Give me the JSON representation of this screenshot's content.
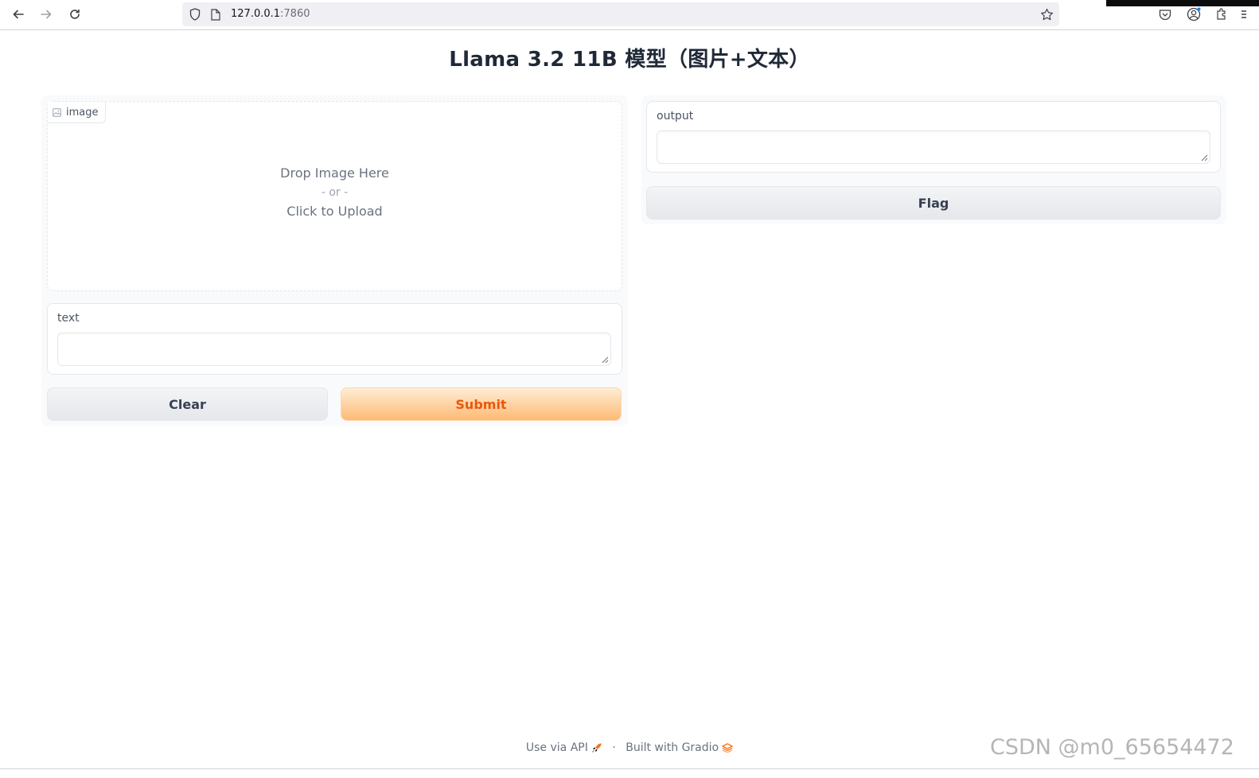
{
  "browser": {
    "url_host": "127.0.0.1",
    "url_port": ":7860"
  },
  "page": {
    "title": "Llama 3.2 11B 模型（图片+文本）"
  },
  "inputs": {
    "image": {
      "label": "image",
      "drop_text": "Drop Image Here",
      "or_text": "- or -",
      "upload_text": "Click to Upload"
    },
    "text": {
      "label": "text",
      "value": ""
    }
  },
  "buttons": {
    "clear": "Clear",
    "submit": "Submit",
    "flag": "Flag"
  },
  "outputs": {
    "output": {
      "label": "output",
      "value": ""
    }
  },
  "footer": {
    "api": "Use via API",
    "separator": "·",
    "built": "Built with Gradio"
  },
  "watermark": "CSDN @m0_65654472",
  "colors": {
    "accent": "#ea580c",
    "submit_bg_top": "#ffedd5",
    "submit_bg_bottom": "#fdba74"
  },
  "icons": [
    "back-icon",
    "forward-icon",
    "reload-icon",
    "shield-icon",
    "page-icon",
    "star-icon",
    "pocket-icon",
    "account-icon",
    "extensions-icon",
    "menu-icon",
    "image-icon",
    "rocket-icon",
    "gradio-logo-icon"
  ]
}
